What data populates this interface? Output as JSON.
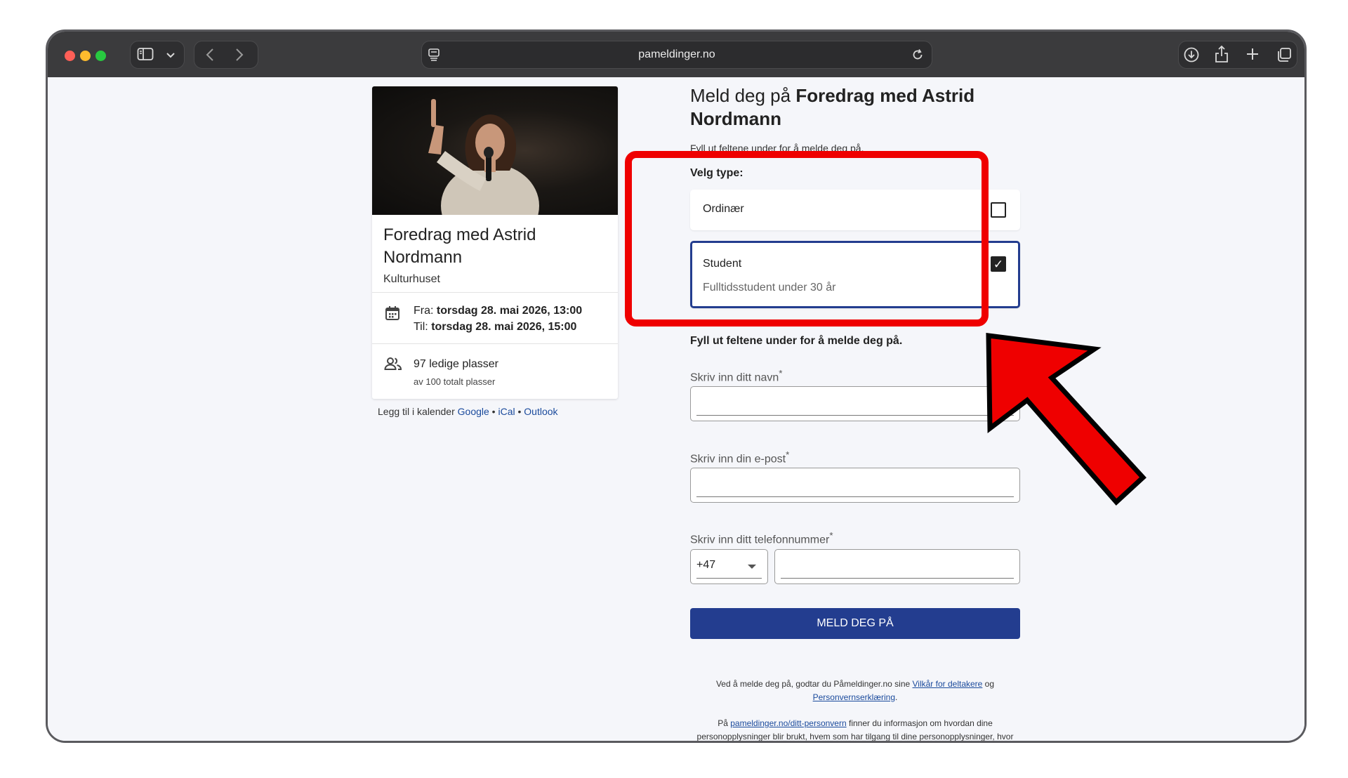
{
  "browser": {
    "url": "pameldinger.no",
    "colors": {
      "close": "#ff5f57",
      "minimize": "#febc2e",
      "zoom": "#28c840"
    },
    "icons": [
      "sidebar-icon",
      "chevron-down-icon",
      "back-icon",
      "forward-icon",
      "reader-icon",
      "reload-icon",
      "download-icon",
      "share-icon",
      "new-tab-icon",
      "tab-overview-icon"
    ]
  },
  "event": {
    "title": "Foredrag med Astrid Nordmann",
    "venue": "Kulturhuset",
    "from_label": "Fra: ",
    "from_value": "torsdag 28. mai 2026, 13:00",
    "to_label": "Til: ",
    "to_value": "torsdag 28. mai 2026, 15:00",
    "seats": "97 ledige plasser",
    "seats_total": "av 100 totalt plasser",
    "calendar_prefix": "Legg til i kalender ",
    "calendar_links": [
      "Google",
      "iCal",
      "Outlook"
    ],
    "separator": " • "
  },
  "form": {
    "title_prefix": "Meld deg på ",
    "title_bold": "Foredrag med Astrid Nordmann",
    "subtitle": "Fyll ut feltene under for å melde deg på.",
    "type_heading": "Velg type:",
    "options": [
      {
        "label": "Ordinær",
        "checked": false
      },
      {
        "label": "Student",
        "sublabel": "Fulltidsstudent under 30 år",
        "checked": true
      }
    ],
    "fields_heading": "Fyll ut feltene under for å melde deg på.",
    "name_label": "Skriv inn ditt navn",
    "email_label": "Skriv inn din e-post",
    "phone_label": "Skriv inn ditt telefonnummer",
    "required_mark": "*",
    "country_code": "+47",
    "submit": "MELD DEG PÅ",
    "terms_1": "Ved å melde deg på, godtar du Påmeldinger.no sine ",
    "terms_link_1": "Vilkår for deltakere",
    "terms_2": " og ",
    "terms_link_2": "Personvernserklæring",
    "terms_3": ".",
    "privacy_1": "På ",
    "privacy_link": "pameldinger.no/ditt-personvern",
    "privacy_2": " finner du informasjon om hvordan dine personopplysninger blir brukt, hvem som har tilgang til dine personopplysninger, hvor lenge dine personopplysninger lagres og hvordan du går frem for å kreve at dine personopplysninger slettes."
  },
  "annotation": {
    "color": "#ef0000"
  }
}
